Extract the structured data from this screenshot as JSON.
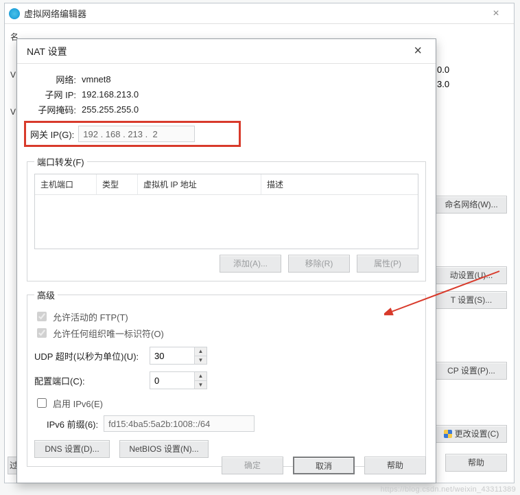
{
  "parent": {
    "title": "虚拟网络编辑器",
    "close": "×",
    "side_label_1": "名",
    "side_label_2": "V",
    "side_label_3": "V",
    "truncated_val_1": "0.0",
    "truncated_val_2": "3.0",
    "btn_rename": "命名网络(W)...",
    "btn_auto": "动设置(U)...",
    "btn_nat_settings": "T 设置(S)...",
    "btn_dhcp": "CP 设置(P)...",
    "btn_change": "更改设置(C)",
    "btn_help": "帮助",
    "btn_restore_trunc": "过"
  },
  "dlg": {
    "title": "NAT 设置",
    "close": "×",
    "network_label": "网络:",
    "network_value": "vmnet8",
    "subnet_ip_label": "子网 IP:",
    "subnet_ip_value": "192.168.213.0",
    "subnet_mask_label": "子网掩码:",
    "subnet_mask_value": "255.255.255.0",
    "gateway_label": "网关 IP(G):",
    "gateway_value": "192 . 168 . 213 .  2",
    "port_forward_legend": "端口转发(F)",
    "col_host_port": "主机端口",
    "col_type": "类型",
    "col_vm_ip": "虚拟机 IP 地址",
    "col_desc": "描述",
    "btn_add": "添加(A)...",
    "btn_remove": "移除(R)",
    "btn_props": "属性(P)",
    "advanced_legend": "高级",
    "chk_ftp": "允许活动的 FTP(T)",
    "chk_oui": "允许任何组织唯一标识符(O)",
    "udp_label": "UDP 超时(以秒为单位)(U):",
    "udp_value": "30",
    "cfg_port_label": "配置端口(C):",
    "cfg_port_value": "0",
    "chk_ipv6": "启用 IPv6(E)",
    "ipv6_prefix_label": "IPv6 前缀(6):",
    "ipv6_prefix_value": "fd15:4ba5:5a2b:1008::/64",
    "btn_dns": "DNS 设置(D)...",
    "btn_netbios": "NetBIOS 设置(N)...",
    "btn_ok": "确定",
    "btn_cancel": "取消",
    "btn_help": "帮助"
  },
  "watermark": "https://blog.csdn.net/weixin_43311389"
}
